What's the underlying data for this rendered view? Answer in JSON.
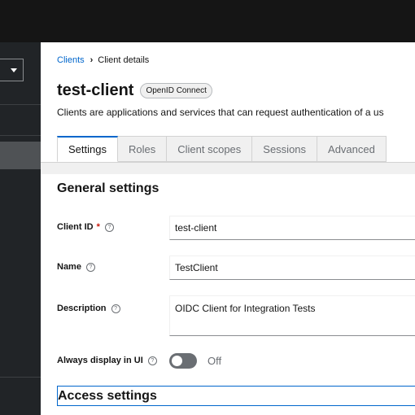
{
  "sidebar": {
    "realm_select_icon": "caret-down-icon"
  },
  "breadcrumb": {
    "items": [
      "Clients",
      "Client details"
    ],
    "separator": "›"
  },
  "header": {
    "title": "test-client",
    "protocol_badge": "OpenID Connect",
    "description": "Clients are applications and services that can request authentication of a us"
  },
  "tabs": [
    "Settings",
    "Roles",
    "Client scopes",
    "Sessions",
    "Advanced"
  ],
  "active_tab": "Settings",
  "general_settings": {
    "title": "General settings",
    "client_id": {
      "label": "Client ID",
      "required_mark": "*",
      "value": "test-client"
    },
    "name": {
      "label": "Name",
      "value": "TestClient"
    },
    "description": {
      "label": "Description",
      "value": "OIDC Client for Integration Tests"
    },
    "always_display": {
      "label": "Always display in UI",
      "state_label": "Off",
      "enabled": false
    }
  },
  "access_settings": {
    "title": "Access settings"
  },
  "help_glyph": "?",
  "colors": {
    "accent": "#0066cc",
    "required": "#c9190b",
    "sidebar_bg": "#212427",
    "masthead_bg": "#151515"
  }
}
